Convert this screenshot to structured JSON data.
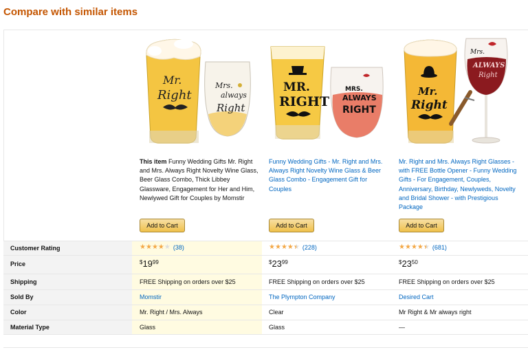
{
  "section_title": "Compare with similar items",
  "this_item_label": "This item",
  "add_to_cart_label": "Add to Cart",
  "row_labels": {
    "rating": "Customer Rating",
    "price": "Price",
    "shipping": "Shipping",
    "sold_by": "Sold By",
    "color": "Color",
    "material": "Material Type"
  },
  "products": [
    {
      "title": "Funny Wedding Gifts Mr. Right and Mrs. Always Right Novelty Wine Glass, Beer Glass Combo, Thick Libbey Glassware, Engagement for Her and Him, Newlywed Gift for Couples by Momstir",
      "stars": 4,
      "reviews": "(38)",
      "price_symbol": "$",
      "price_whole": "19",
      "price_cents": "99",
      "shipping": "FREE Shipping on orders over $25",
      "sold_by": "Momstir",
      "color": "Mr. Right / Mrs. Always",
      "material": "Glass"
    },
    {
      "title": "Funny Wedding Gifts - Mr. Right and Mrs. Always Right Novelty Wine Glass & Beer Glass Combo - Engagement Gift for Couples",
      "stars": 4.5,
      "reviews": "(228)",
      "price_symbol": "$",
      "price_whole": "23",
      "price_cents": "99",
      "shipping": "FREE Shipping on orders over $25",
      "sold_by": "The Plympton Company",
      "color": "Clear",
      "material": "Glass"
    },
    {
      "title": "Mr. Right and Mrs. Always Right Glasses -with FREE Bottle Opener - Funny Wedding Gifts - For Engagement, Couples, Anniversary, Birthday, Newlyweds, Novelty and Bridal Shower - with Prestigious Package",
      "stars": 4.5,
      "reviews": "(681)",
      "price_symbol": "$",
      "price_whole": "23",
      "price_cents": "50",
      "shipping": "FREE Shipping on orders over $25",
      "sold_by": "Desired Cart",
      "color": "Mr Right & Mr always right",
      "material": "—"
    }
  ],
  "images": [
    {
      "left_lettering": [
        "Mr.",
        "Right"
      ],
      "right_lettering": [
        "Mrs.",
        "always",
        "Right"
      ]
    },
    {
      "left_lettering": [
        "MR.",
        "RIGHT"
      ],
      "right_lettering": [
        "MRS.",
        "ALWAYS",
        "RIGHT"
      ]
    },
    {
      "left_lettering": [
        "Mr.",
        "Right"
      ],
      "right_lettering": [
        "Mrs.",
        "ALWAYS",
        "Right"
      ]
    }
  ],
  "colors": {
    "title": "#c45500",
    "link": "#0066c0",
    "star": "#f3a847",
    "highlight": "#fffbe1",
    "label_bg": "#f3f3f3",
    "button_top": "#f7dfa5",
    "button_bottom": "#f0c14b"
  }
}
